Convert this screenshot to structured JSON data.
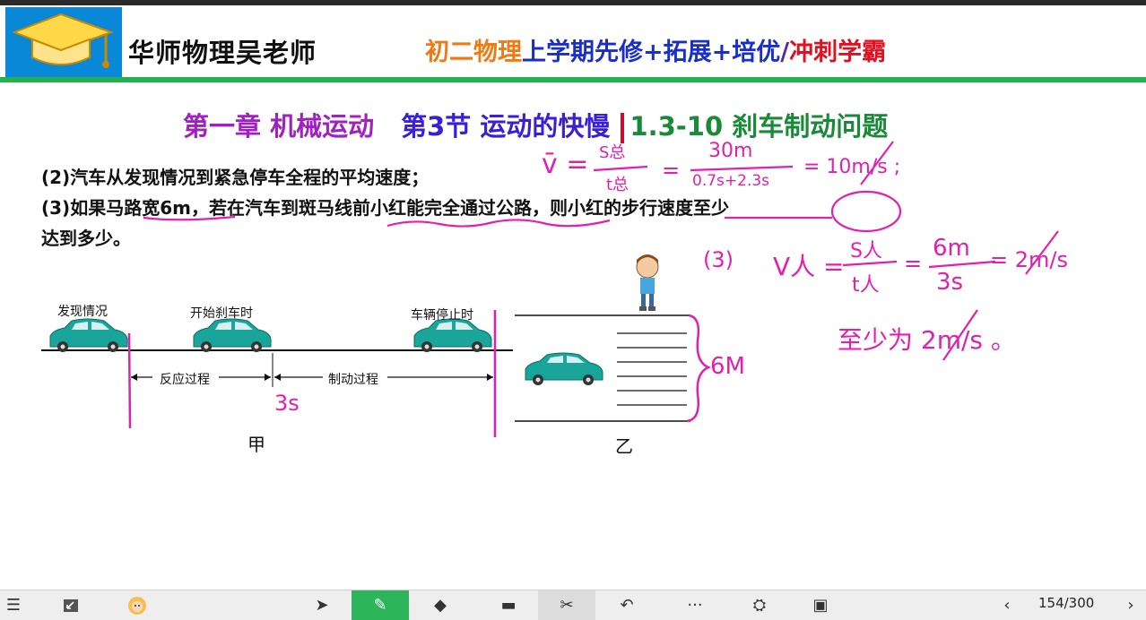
{
  "header": {
    "brand": "华师物理吴老师",
    "slogan_1": "初二物理",
    "slogan_2": "上学期先修+拓展+培优",
    "slogan_sep": "/",
    "slogan_3": "冲刺学霸"
  },
  "chapter": {
    "part_1": "第一章 机械运动",
    "part_2": "第3节 运动的快慢",
    "part_3": "1.3-10 刹车制动问题"
  },
  "questions": {
    "q2": "(2)汽车从发现情况到紧急停车全程的平均速度；",
    "q3_line1": "(3)如果马路宽6m，若在汽车到斑马线前小红能完全通过公路，则小红的步行速度至少",
    "q3_line2": "达到多少。"
  },
  "diagram": {
    "label_found": "发现情况",
    "label_brake_start": "开始刹车时",
    "label_stop": "车辆停止时",
    "label_reaction": "反应过程",
    "label_braking": "制动过程",
    "label_jia": "甲",
    "label_yi": "乙"
  },
  "handwriting": {
    "eq1_lhs": "v̄ =",
    "eq1_num1": "S总",
    "eq1_den1": "t总",
    "eq1_eq": "=",
    "eq1_num2": "30m",
    "eq1_den2": "0.7s+2.3s",
    "eq1_res": "= 10m/s ;",
    "eq2_label": "(3)",
    "eq2_lhs": "V人 =",
    "eq2_num1": "S人",
    "eq2_den1": "t人",
    "eq2_eq": "=",
    "eq2_num2": "6m",
    "eq2_den2": "3s",
    "eq2_res": "= 2m/s",
    "eq3": "至少为 2m/s 。",
    "time_3s": "3s",
    "width_6m": "6M"
  },
  "toolbar": {
    "page": "154/300",
    "icons": [
      "menu-icon",
      "minimize-icon",
      "avatar-icon",
      "pointer-icon",
      "pen-icon",
      "eraser-icon",
      "screen-icon",
      "scissors-icon",
      "undo-icon",
      "more-icon",
      "stamp-icon",
      "window-icon",
      "prev-icon",
      "next-icon"
    ]
  },
  "colors": {
    "ink": "#e21fae",
    "green_bar": "#22b14c",
    "car": "#1aa59a",
    "active_tool": "#2cb55a"
  }
}
